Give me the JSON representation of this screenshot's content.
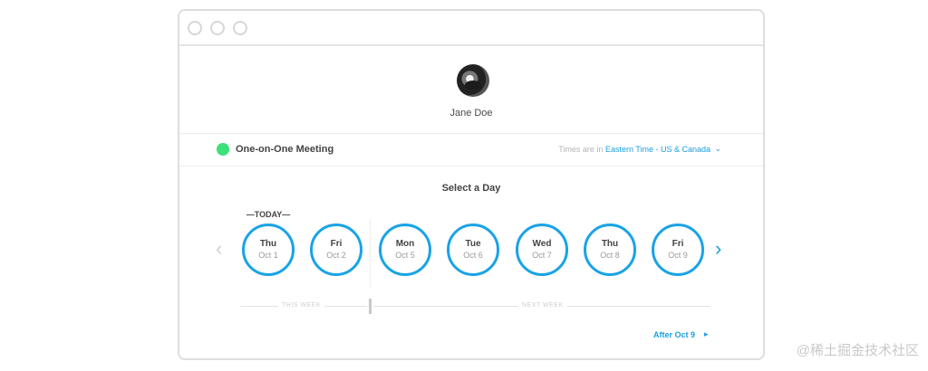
{
  "profile": {
    "name": "Jane Doe"
  },
  "event": {
    "title": "One-on-One Meeting",
    "tz_prefix": "Times are in",
    "tz_value": "Eastern Time - US & Canada",
    "tz_chevron": "⌄",
    "dot_color": "#3ce07a"
  },
  "calendar": {
    "title": "Select a Day",
    "today_label": "—TODAY—",
    "prev_icon": "‹",
    "next_icon": "›",
    "days": [
      {
        "name": "Thu",
        "date": "Oct 1"
      },
      {
        "name": "Fri",
        "date": "Oct 2"
      },
      {
        "name": "Mon",
        "date": "Oct 5"
      },
      {
        "name": "Tue",
        "date": "Oct 6"
      },
      {
        "name": "Wed",
        "date": "Oct 7"
      },
      {
        "name": "Thu",
        "date": "Oct 8"
      },
      {
        "name": "Fri",
        "date": "Oct 9"
      }
    ],
    "this_week": "THIS WEEK",
    "next_week": "NEXT WEEK",
    "after_label": "After Oct 9",
    "after_icon": "▸"
  },
  "watermark": "@稀土掘金技术社区",
  "colors": {
    "accent": "#1aa3e6",
    "text": "#444444"
  }
}
